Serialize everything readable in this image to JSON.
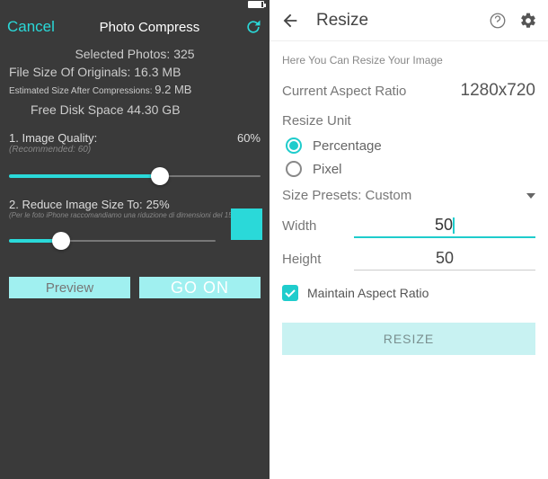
{
  "left": {
    "nav": {
      "cancel": "Cancel",
      "title": "Photo Compress"
    },
    "info": {
      "selected_label": "Selected Photos:",
      "selected_value": "325",
      "filesize_label": "File Size Of Originals:",
      "filesize_value": "16.3 MB",
      "est_label": "Estimated Size After Compressions:",
      "est_value": "9.2 MB",
      "freedisk_label": "Free Disk Space",
      "freedisk_value": "44.30 GB"
    },
    "quality": {
      "title": "1. Image Quality:",
      "value": "60%",
      "hint": "(Recommended: 60)",
      "percent": 60
    },
    "reduce": {
      "title": "2. Reduce Image Size To:",
      "value": "25%",
      "hint": "(Per le foto iPhone raccomandiamo una riduzione di dimensioni del 15%)",
      "percent": 25
    },
    "buttons": {
      "preview": "Preview",
      "go": "GO ON"
    }
  },
  "right": {
    "title": "Resize",
    "hint": "Here You Can Resize Your Image",
    "aspect_label": "Current Aspect Ratio",
    "aspect_value": "1280x720",
    "unit_label": "Resize Unit",
    "unit_percentage": "Percentage",
    "unit_pixel": "Pixel",
    "presets_label": "Size Presets:",
    "presets_value": "Custom",
    "width_label": "Width",
    "width_value": "50",
    "height_label": "Height",
    "height_value": "50",
    "maintain_label": "Maintain Aspect Ratio",
    "resize_btn": "RESIZE"
  }
}
